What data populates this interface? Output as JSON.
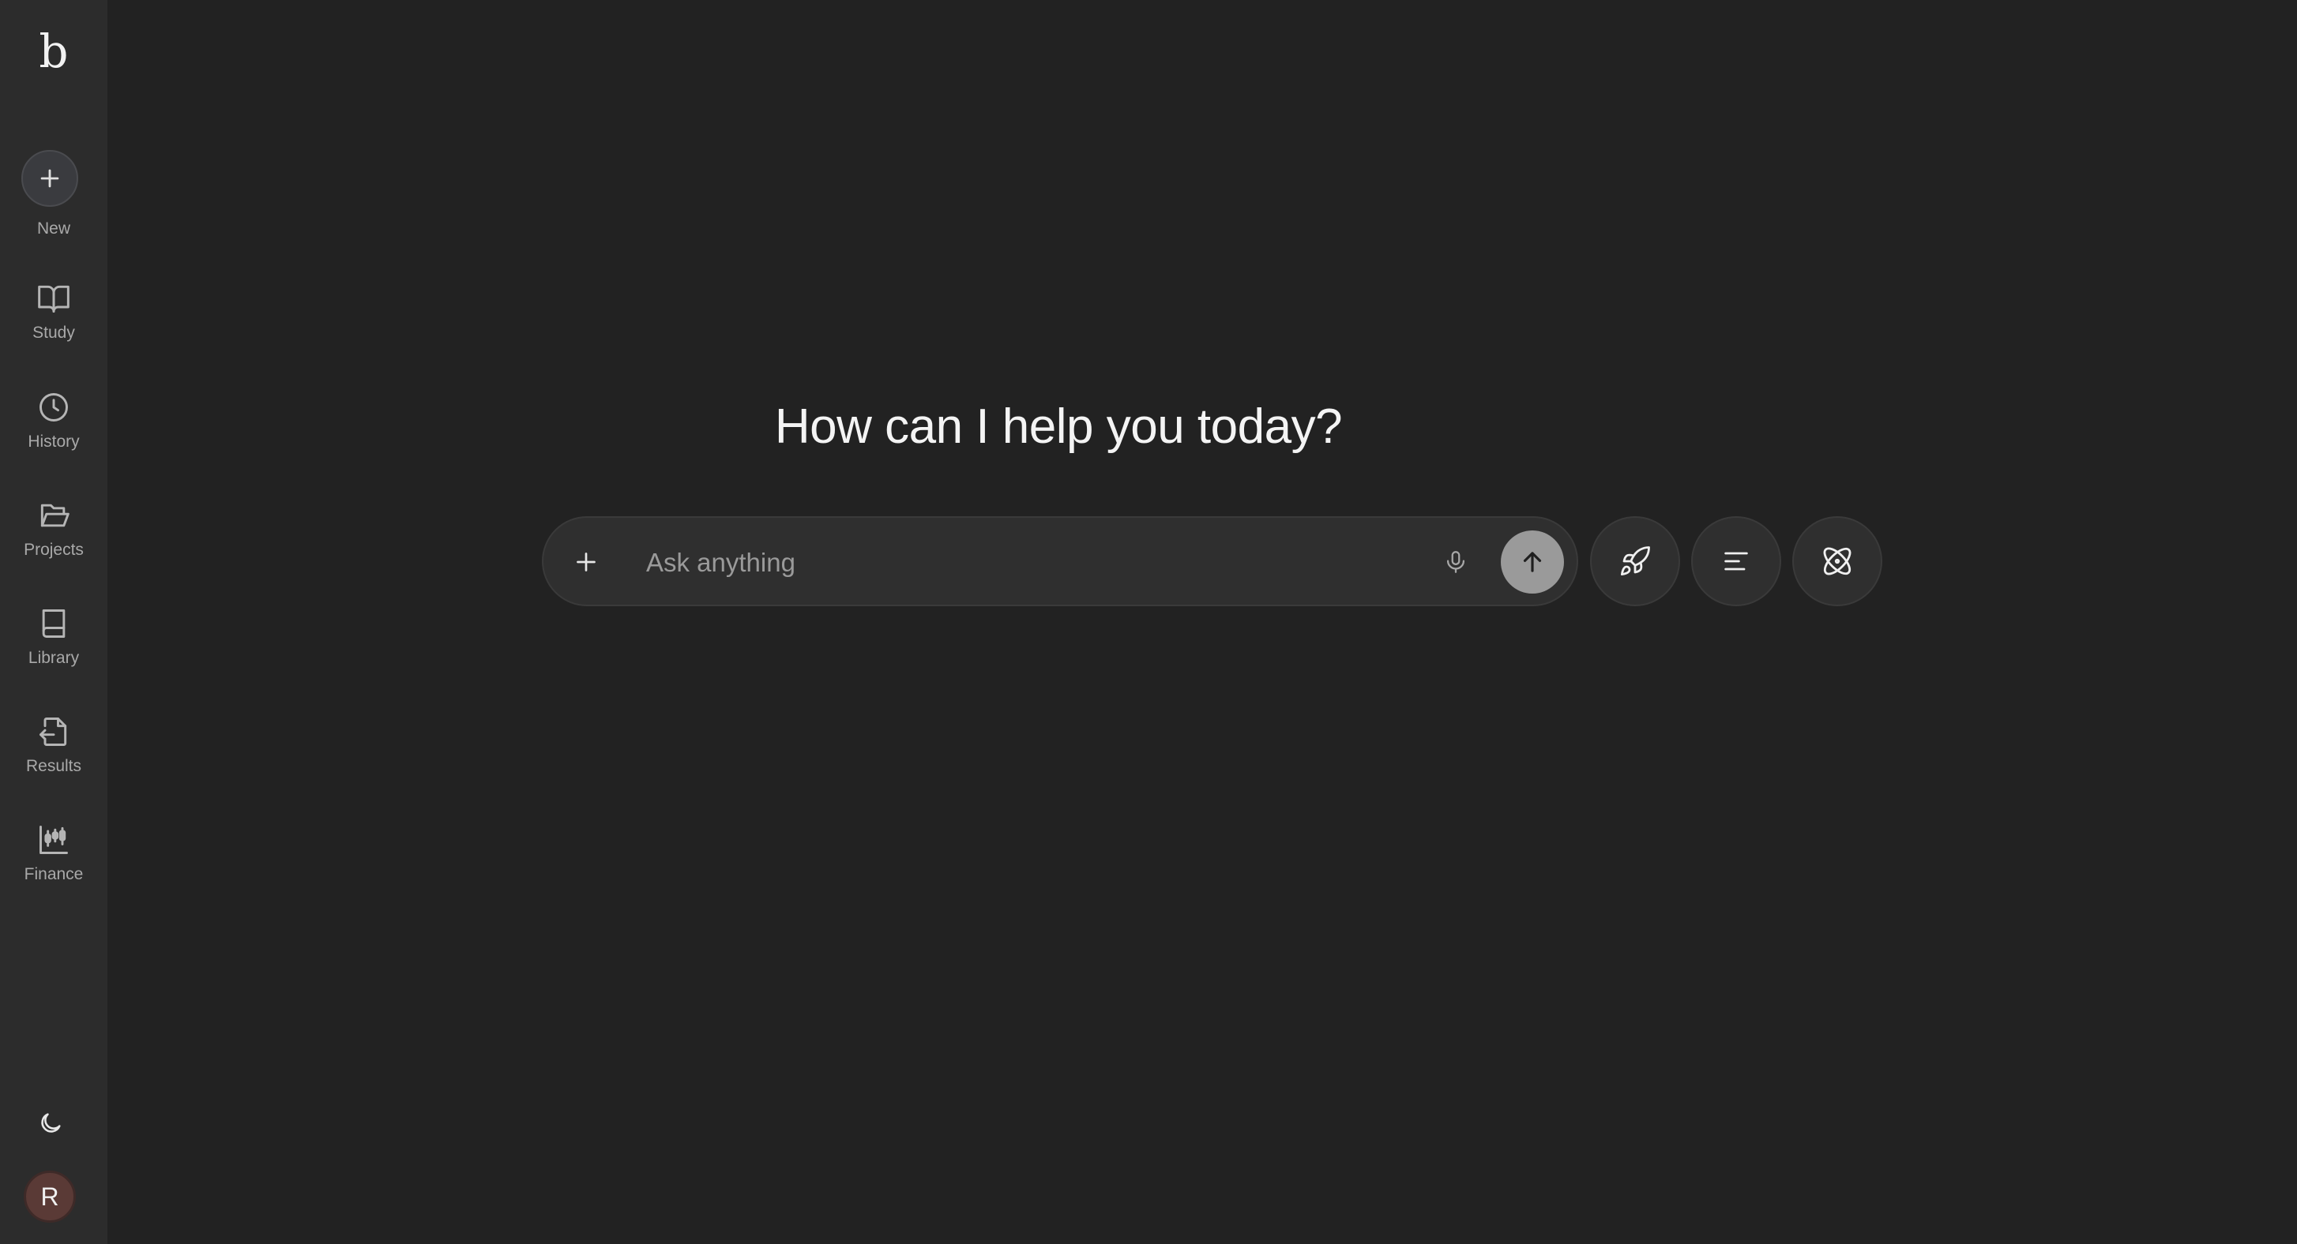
{
  "sidebar": {
    "logo": "b",
    "new_label": "New",
    "items": [
      {
        "label": "Study",
        "icon": "book-open-icon"
      },
      {
        "label": "History",
        "icon": "clock-icon"
      },
      {
        "label": "Projects",
        "icon": "folder-open-icon"
      },
      {
        "label": "Library",
        "icon": "book-icon"
      },
      {
        "label": "Results",
        "icon": "file-import-icon"
      },
      {
        "label": "Finance",
        "icon": "chart-candlestick-icon"
      }
    ],
    "theme_icon": "moon-icon",
    "avatar_initial": "R"
  },
  "main": {
    "headline": "How can I help you today?",
    "prompt": {
      "placeholder": "Ask anything",
      "value": ""
    },
    "mode_buttons": [
      {
        "icon": "rocket-icon"
      },
      {
        "icon": "text-align-left-icon"
      },
      {
        "icon": "atom-icon"
      }
    ]
  },
  "colors": {
    "background": "#222222",
    "sidebar": "#2c2c2c",
    "input_background": "#2f2f2f",
    "send_button": "#9a9a9a",
    "avatar": "#5a3a36"
  }
}
